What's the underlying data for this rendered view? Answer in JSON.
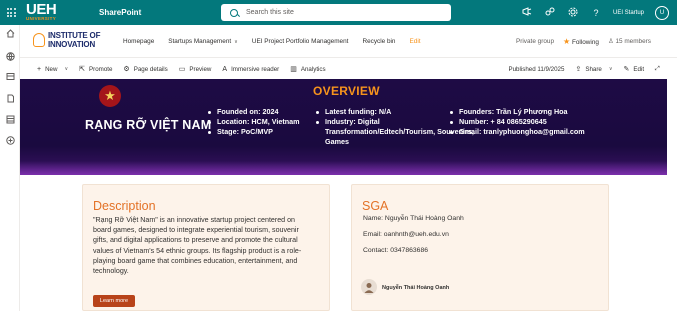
{
  "suitebar": {
    "brand_big": "UEH",
    "brand_small": "UNIVERSITY",
    "app_name": "SharePoint",
    "search_placeholder": "Search this site",
    "user_name": "UEI Startup",
    "user_initial": "U",
    "icons": [
      "megaphone-icon",
      "share-icon",
      "gear-icon",
      "help-icon"
    ]
  },
  "leftrail": {
    "icons": [
      "home-icon",
      "globe-icon",
      "feed-icon",
      "document-icon",
      "list-icon",
      "add-icon"
    ]
  },
  "site": {
    "logo_line1": "INSTITUTE OF",
    "logo_line2": "INNOVATION",
    "nav": [
      {
        "label": "Homepage"
      },
      {
        "label": "Startups Management"
      },
      {
        "label": "UEI Project Portfolio Management"
      },
      {
        "label": "Recycle bin"
      },
      {
        "label": "Edit"
      }
    ],
    "privacy": "Private group",
    "following": "Following",
    "members": "15 members"
  },
  "commandbar": {
    "new": "New",
    "promote": "Promote",
    "page_details": "Page details",
    "preview": "Preview",
    "immersive": "Immersive reader",
    "analytics": "Analytics",
    "published": "Published 11/9/2025",
    "share": "Share",
    "edit": "Edit"
  },
  "banner": {
    "title": "OVERVIEW",
    "name": "RẠNG RỠ VIỆT NAM",
    "col1": [
      "Founded on: 2024",
      "Location: HCM, Vietnam",
      "Stage: PoC/MVP"
    ],
    "col2": [
      "Latest funding: N/A",
      "Industry: Digital Transformation/Edtech/Tourism, Souvenirs, Games"
    ],
    "col3": [
      "Founders: Trần Lý Phương Hoa",
      "Number: + 84 0865290645",
      "Gmail: tranlyphuonghoa@gmail.com"
    ],
    "colors": {
      "background": "#1e0b45",
      "accent": "#f7941d"
    }
  },
  "description": {
    "heading": "Description",
    "body": "\"Rạng Rỡ Việt Nam\" is an innovative startup project centered on board games, designed to integrate experiential tourism, souvenir gifts, and digital applications to preserve and promote the cultural values of Vietnam's 54 ethnic groups. Its flagship product is a role-playing board game that combines education, entertainment, and technology.",
    "button": "Learn more"
  },
  "sga": {
    "heading": "SGA",
    "name": "Name: Nguyễn Thái Hoàng Oanh",
    "email": "Email: oanhnth@ueh.edu.vn",
    "contact": "Contact: 0347863686",
    "person_name": "Nguyễn Thái Hoàng Oanh"
  }
}
